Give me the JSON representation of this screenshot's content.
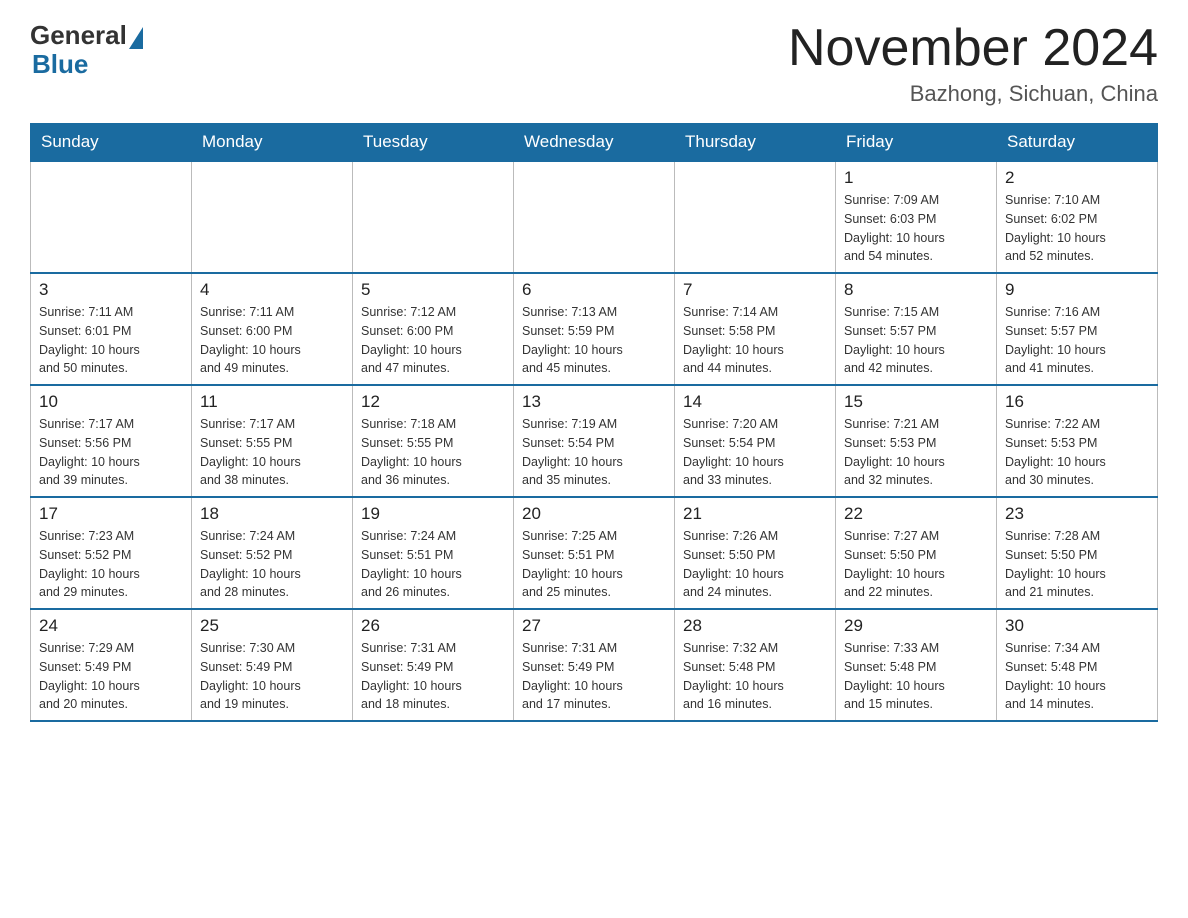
{
  "logo": {
    "general": "General",
    "blue": "Blue"
  },
  "title": "November 2024",
  "subtitle": "Bazhong, Sichuan, China",
  "weekdays": [
    "Sunday",
    "Monday",
    "Tuesday",
    "Wednesday",
    "Thursday",
    "Friday",
    "Saturday"
  ],
  "weeks": [
    [
      {
        "day": "",
        "info": ""
      },
      {
        "day": "",
        "info": ""
      },
      {
        "day": "",
        "info": ""
      },
      {
        "day": "",
        "info": ""
      },
      {
        "day": "",
        "info": ""
      },
      {
        "day": "1",
        "info": "Sunrise: 7:09 AM\nSunset: 6:03 PM\nDaylight: 10 hours\nand 54 minutes."
      },
      {
        "day": "2",
        "info": "Sunrise: 7:10 AM\nSunset: 6:02 PM\nDaylight: 10 hours\nand 52 minutes."
      }
    ],
    [
      {
        "day": "3",
        "info": "Sunrise: 7:11 AM\nSunset: 6:01 PM\nDaylight: 10 hours\nand 50 minutes."
      },
      {
        "day": "4",
        "info": "Sunrise: 7:11 AM\nSunset: 6:00 PM\nDaylight: 10 hours\nand 49 minutes."
      },
      {
        "day": "5",
        "info": "Sunrise: 7:12 AM\nSunset: 6:00 PM\nDaylight: 10 hours\nand 47 minutes."
      },
      {
        "day": "6",
        "info": "Sunrise: 7:13 AM\nSunset: 5:59 PM\nDaylight: 10 hours\nand 45 minutes."
      },
      {
        "day": "7",
        "info": "Sunrise: 7:14 AM\nSunset: 5:58 PM\nDaylight: 10 hours\nand 44 minutes."
      },
      {
        "day": "8",
        "info": "Sunrise: 7:15 AM\nSunset: 5:57 PM\nDaylight: 10 hours\nand 42 minutes."
      },
      {
        "day": "9",
        "info": "Sunrise: 7:16 AM\nSunset: 5:57 PM\nDaylight: 10 hours\nand 41 minutes."
      }
    ],
    [
      {
        "day": "10",
        "info": "Sunrise: 7:17 AM\nSunset: 5:56 PM\nDaylight: 10 hours\nand 39 minutes."
      },
      {
        "day": "11",
        "info": "Sunrise: 7:17 AM\nSunset: 5:55 PM\nDaylight: 10 hours\nand 38 minutes."
      },
      {
        "day": "12",
        "info": "Sunrise: 7:18 AM\nSunset: 5:55 PM\nDaylight: 10 hours\nand 36 minutes."
      },
      {
        "day": "13",
        "info": "Sunrise: 7:19 AM\nSunset: 5:54 PM\nDaylight: 10 hours\nand 35 minutes."
      },
      {
        "day": "14",
        "info": "Sunrise: 7:20 AM\nSunset: 5:54 PM\nDaylight: 10 hours\nand 33 minutes."
      },
      {
        "day": "15",
        "info": "Sunrise: 7:21 AM\nSunset: 5:53 PM\nDaylight: 10 hours\nand 32 minutes."
      },
      {
        "day": "16",
        "info": "Sunrise: 7:22 AM\nSunset: 5:53 PM\nDaylight: 10 hours\nand 30 minutes."
      }
    ],
    [
      {
        "day": "17",
        "info": "Sunrise: 7:23 AM\nSunset: 5:52 PM\nDaylight: 10 hours\nand 29 minutes."
      },
      {
        "day": "18",
        "info": "Sunrise: 7:24 AM\nSunset: 5:52 PM\nDaylight: 10 hours\nand 28 minutes."
      },
      {
        "day": "19",
        "info": "Sunrise: 7:24 AM\nSunset: 5:51 PM\nDaylight: 10 hours\nand 26 minutes."
      },
      {
        "day": "20",
        "info": "Sunrise: 7:25 AM\nSunset: 5:51 PM\nDaylight: 10 hours\nand 25 minutes."
      },
      {
        "day": "21",
        "info": "Sunrise: 7:26 AM\nSunset: 5:50 PM\nDaylight: 10 hours\nand 24 minutes."
      },
      {
        "day": "22",
        "info": "Sunrise: 7:27 AM\nSunset: 5:50 PM\nDaylight: 10 hours\nand 22 minutes."
      },
      {
        "day": "23",
        "info": "Sunrise: 7:28 AM\nSunset: 5:50 PM\nDaylight: 10 hours\nand 21 minutes."
      }
    ],
    [
      {
        "day": "24",
        "info": "Sunrise: 7:29 AM\nSunset: 5:49 PM\nDaylight: 10 hours\nand 20 minutes."
      },
      {
        "day": "25",
        "info": "Sunrise: 7:30 AM\nSunset: 5:49 PM\nDaylight: 10 hours\nand 19 minutes."
      },
      {
        "day": "26",
        "info": "Sunrise: 7:31 AM\nSunset: 5:49 PM\nDaylight: 10 hours\nand 18 minutes."
      },
      {
        "day": "27",
        "info": "Sunrise: 7:31 AM\nSunset: 5:49 PM\nDaylight: 10 hours\nand 17 minutes."
      },
      {
        "day": "28",
        "info": "Sunrise: 7:32 AM\nSunset: 5:48 PM\nDaylight: 10 hours\nand 16 minutes."
      },
      {
        "day": "29",
        "info": "Sunrise: 7:33 AM\nSunset: 5:48 PM\nDaylight: 10 hours\nand 15 minutes."
      },
      {
        "day": "30",
        "info": "Sunrise: 7:34 AM\nSunset: 5:48 PM\nDaylight: 10 hours\nand 14 minutes."
      }
    ]
  ]
}
